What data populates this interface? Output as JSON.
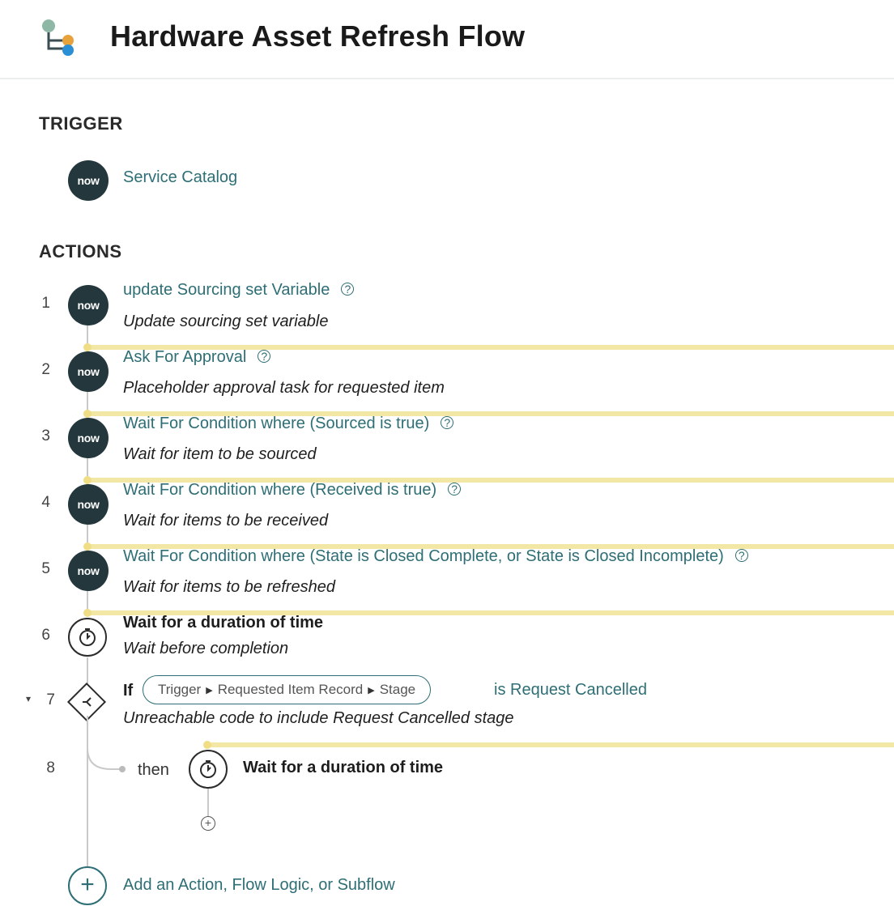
{
  "header": {
    "title": "Hardware Asset Refresh Flow",
    "icon": "flow-icon"
  },
  "trigger": {
    "section_label": "TRIGGER",
    "badge": "now",
    "label": "Service Catalog"
  },
  "actions": {
    "section_label": "ACTIONS",
    "items": [
      {
        "num": "1",
        "badge": "now",
        "title": "update Sourcing set Variable",
        "help": "?",
        "desc": "Update sourcing set variable"
      },
      {
        "num": "2",
        "badge": "now",
        "title": "Ask For Approval",
        "help": "?",
        "desc": "Placeholder approval task for requested item"
      },
      {
        "num": "3",
        "badge": "now",
        "title": "Wait For Condition where (Sourced is true)",
        "help": "?",
        "desc": "Wait for item to be sourced"
      },
      {
        "num": "4",
        "badge": "now",
        "title": "Wait For Condition where (Received is true)",
        "help": "?",
        "desc": "Wait for items to be received"
      },
      {
        "num": "5",
        "badge": "now",
        "title": "Wait For Condition where (State is Closed Complete, or State is Closed Incomplete)",
        "help": "?",
        "desc": "Wait for items to be refreshed"
      },
      {
        "num": "6",
        "title": "Wait for a duration of time",
        "desc": "Wait before completion"
      },
      {
        "num": "7",
        "if_label": "If",
        "pill": [
          "Trigger",
          "Requested Item Record",
          "Stage"
        ],
        "condition": "is Request Cancelled",
        "desc": "Unreachable code to include Request Cancelled stage"
      },
      {
        "num": "8",
        "then_label": "then",
        "title": "Wait for a duration of time"
      }
    ]
  },
  "add_action": {
    "label": "Add an Action, Flow Logic, or Subflow"
  },
  "colors": {
    "accent": "#2e6e75",
    "badge_bg": "#23373c",
    "highlight": "#f3e7a6"
  }
}
